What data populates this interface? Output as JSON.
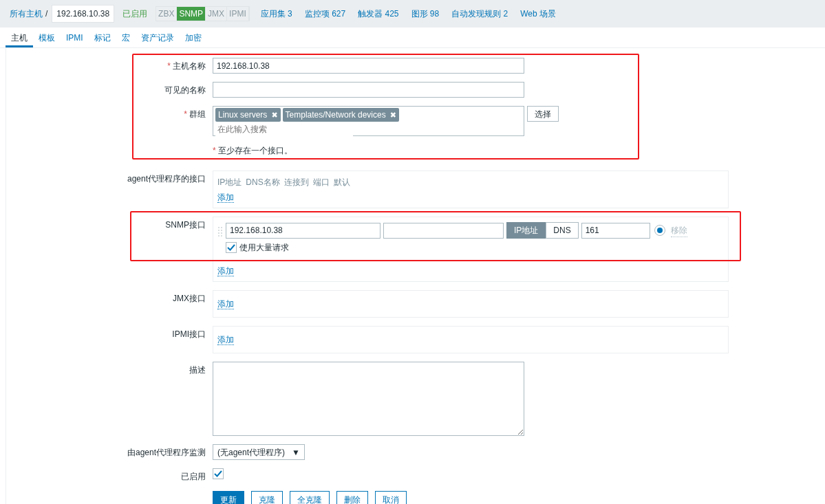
{
  "breadcrumb": {
    "root": "所有主机",
    "separator": "/",
    "current": "192.168.10.38"
  },
  "status": "已启用",
  "protocols": [
    {
      "label": "ZBX",
      "active": false
    },
    {
      "label": "SNMP",
      "active": true
    },
    {
      "label": "JMX",
      "active": false
    },
    {
      "label": "IPMI",
      "active": false
    }
  ],
  "links": [
    {
      "label": "应用集",
      "count": "3"
    },
    {
      "label": "监控项",
      "count": "627"
    },
    {
      "label": "触发器",
      "count": "425"
    },
    {
      "label": "图形",
      "count": "98"
    },
    {
      "label": "自动发现规则",
      "count": "2"
    },
    {
      "label": "Web 场景"
    }
  ],
  "tabs": [
    {
      "label": "主机",
      "selected": true
    },
    {
      "label": "模板",
      "selected": false
    },
    {
      "label": "IPMI",
      "selected": false
    },
    {
      "label": "标记",
      "selected": false
    },
    {
      "label": "宏",
      "selected": false
    },
    {
      "label": "资产记录",
      "selected": false
    },
    {
      "label": "加密",
      "selected": false
    }
  ],
  "sections": [
    {
      "highlighted": true,
      "rows": [
        {
          "kind": "text",
          "label": "主机名称",
          "required": true,
          "value": "192.168.10.38"
        },
        {
          "kind": "text",
          "label": "可见的名称",
          "required": false,
          "value": ""
        },
        {
          "kind": "multiselect",
          "label": "群组",
          "required": true,
          "tags": [
            "Linux servers",
            "Templates/Network devices"
          ],
          "remove_glyph": "✖",
          "placeholder": "在此输入搜索",
          "button": "选择"
        },
        {
          "kind": "note",
          "mark": "*",
          "text": "至少存在一个接口。"
        }
      ]
    },
    {
      "highlighted": false,
      "rows": [
        {
          "kind": "interface",
          "label": "agent代理程序的接口",
          "columns": [
            "IP地址",
            "DNS名称",
            "连接到",
            "端口",
            "默认"
          ],
          "add": "添加"
        }
      ]
    },
    {
      "highlighted": true,
      "rows": [
        {
          "kind": "interface",
          "label": "SNMP接口",
          "entry": {
            "ip": "192.168.10.38",
            "connect": [
              {
                "label": "IP地址",
                "selected": true
              },
              {
                "label": "DNS",
                "selected": false
              }
            ],
            "port": "161",
            "default": true,
            "remove": "移除",
            "remove_disabled": true,
            "bulk": {
              "label": "使用大量请求",
              "checked": true
            }
          },
          "add": "添加"
        }
      ]
    },
    {
      "highlighted": false,
      "rows": [
        {
          "kind": "interface",
          "label": "JMX接口",
          "add": "添加"
        },
        {
          "kind": "interface",
          "label": "IPMI接口",
          "add": "添加"
        },
        {
          "kind": "textarea",
          "label": "描述",
          "value": ""
        },
        {
          "kind": "select",
          "label": "由agent代理程序监测",
          "value": "(无agent代理程序)",
          "caret": "▼"
        },
        {
          "kind": "checkbox",
          "label": "已启用",
          "checked": true
        },
        {
          "kind": "buttons",
          "buttons": [
            {
              "label": "更新",
              "primary": true
            },
            {
              "label": "克隆",
              "primary": false
            },
            {
              "label": "全克隆",
              "primary": false
            },
            {
              "label": "删除",
              "primary": false
            },
            {
              "label": "取消",
              "primary": false
            }
          ]
        }
      ]
    }
  ]
}
